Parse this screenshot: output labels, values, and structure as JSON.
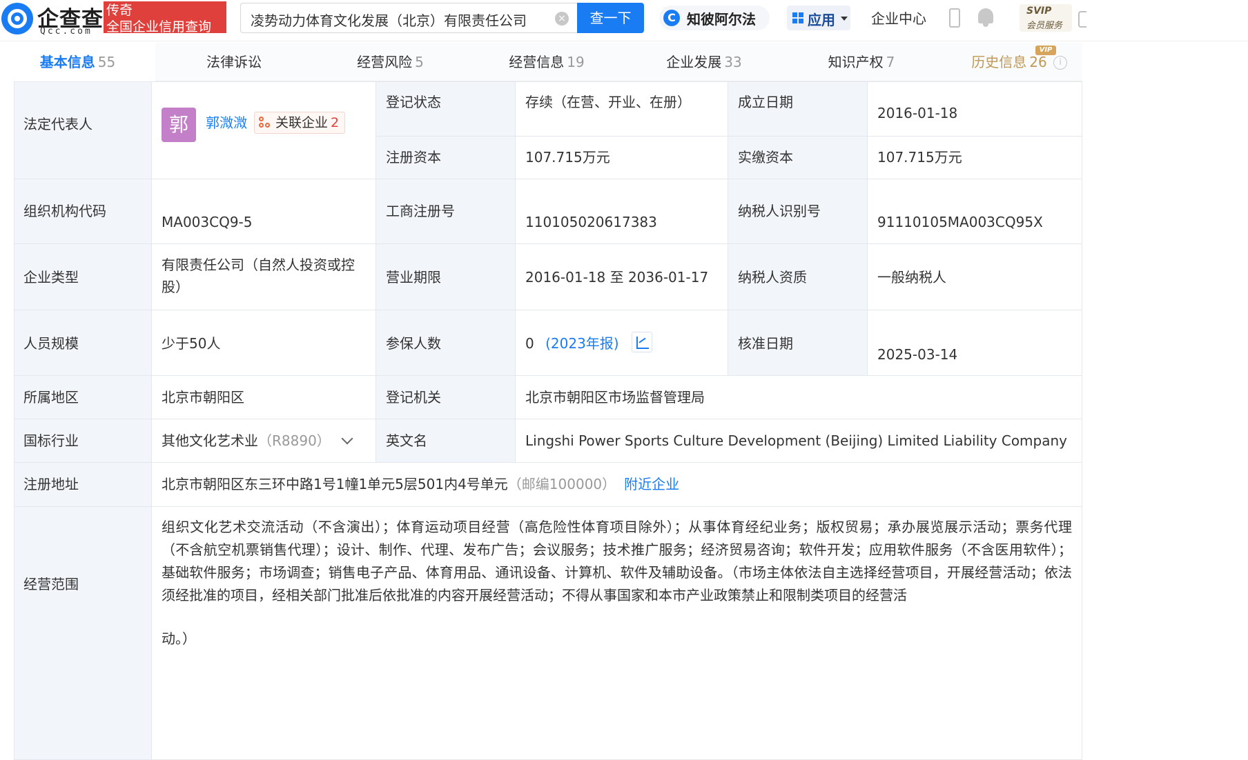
{
  "header": {
    "logo_cn": "企查查",
    "logo_en": "Qcc.com",
    "legend_line1": "传奇",
    "legend_line2": "全国企业信用查询",
    "search_value": "凌势动力体育文化发展（北京）有限责任公司",
    "clear_symbol": "×",
    "search_button": "查一下",
    "zb_icon_letter": "C",
    "zb_label": "知彼阿尔法",
    "app_label": "应用",
    "center_label": "企业中心",
    "svip_top": "SVIP",
    "svip_bottom": "会员服务",
    "brand_color": "#1a7cf2",
    "badge_color": "#e0403c"
  },
  "tabs": [
    {
      "label": "基本信息",
      "count": "55"
    },
    {
      "label": "法律诉讼",
      "count": ""
    },
    {
      "label": "经营风险",
      "count": "5"
    },
    {
      "label": "经营信息",
      "count": "19"
    },
    {
      "label": "企业发展",
      "count": "33"
    },
    {
      "label": "知识产权",
      "count": "7"
    },
    {
      "label": "历史信息",
      "count": "26"
    }
  ],
  "vip_tag": "VIP",
  "info_symbol": "i",
  "info": {
    "legal_rep_label": "法定代表人",
    "legal_rep_avatar": "郭",
    "legal_rep_name": "郭溦溦",
    "related_label": "关联企业",
    "related_count": "2",
    "reg_status_label": "登记状态",
    "reg_status": "存续（在营、开业、在册）",
    "founded_label": "成立日期",
    "founded": "2016-01-18",
    "reg_capital_label": "注册资本",
    "reg_capital": "107.715万元",
    "paid_capital_label": "实缴资本",
    "paid_capital": "107.715万元",
    "org_code_label": "组织机构代码",
    "org_code": "MA003CQ9-5",
    "biz_reg_no_label": "工商注册号",
    "biz_reg_no": "110105020617383",
    "taxpayer_id_label": "纳税人识别号",
    "taxpayer_id": "91110105MA003CQ95X",
    "company_type_label": "企业类型",
    "company_type": "有限责任公司（自然人投资或控股）",
    "biz_term_label": "营业期限",
    "biz_term": "2016-01-18 至 2036-01-17",
    "taxpayer_qual_label": "纳税人资质",
    "taxpayer_qual": "一般纳税人",
    "staff_size_label": "人员规模",
    "staff_size": "少于50人",
    "insured_label": "参保人数",
    "insured": "0",
    "insured_year": "(2023年报)",
    "approved_label": "核准日期",
    "approved": "2025-03-14",
    "region_label": "所属地区",
    "region": "北京市朝阳区",
    "authority_label": "登记机关",
    "authority": "北京市朝阳区市场监督管理局",
    "industry_label": "国标行业",
    "industry": "其他文化艺术业",
    "industry_code": "（R8890）",
    "english_name_label": "英文名",
    "english_name": "Lingshi Power Sports Culture Development (Beijing) Limited Liability Company",
    "address_label": "注册地址",
    "address": "北京市朝阳区东三环中路1号1幢1单元5层501内4号单元",
    "postcode": "（邮编100000）",
    "nearby_label": "附近企业",
    "scope_label": "经营范围",
    "scope_text": "组织文化艺术交流活动（不含演出）；体育运动项目经营（高危险性体育项目除外）；从事体育经纪业务；版权贸易；承办展览展示活动；票务代理（不含航空机票销售代理）；设计、制作、代理、发布广告；会议服务；技术推广服务；经济贸易咨询；软件开发；应用软件服务（不含医用软件）；基础软件服务；市场调查；销售电子产品、体育用品、通讯设备、计算机、软件及辅助设备。（市场主体依法自主选择经营项目，开展经营活动；依法须经批准的项目，经相关部门批准后依批准的内容开展经营活动；不得从事国家和本市产业政策禁止和限制类项目的经营活",
    "scope_tail": "动。）"
  }
}
